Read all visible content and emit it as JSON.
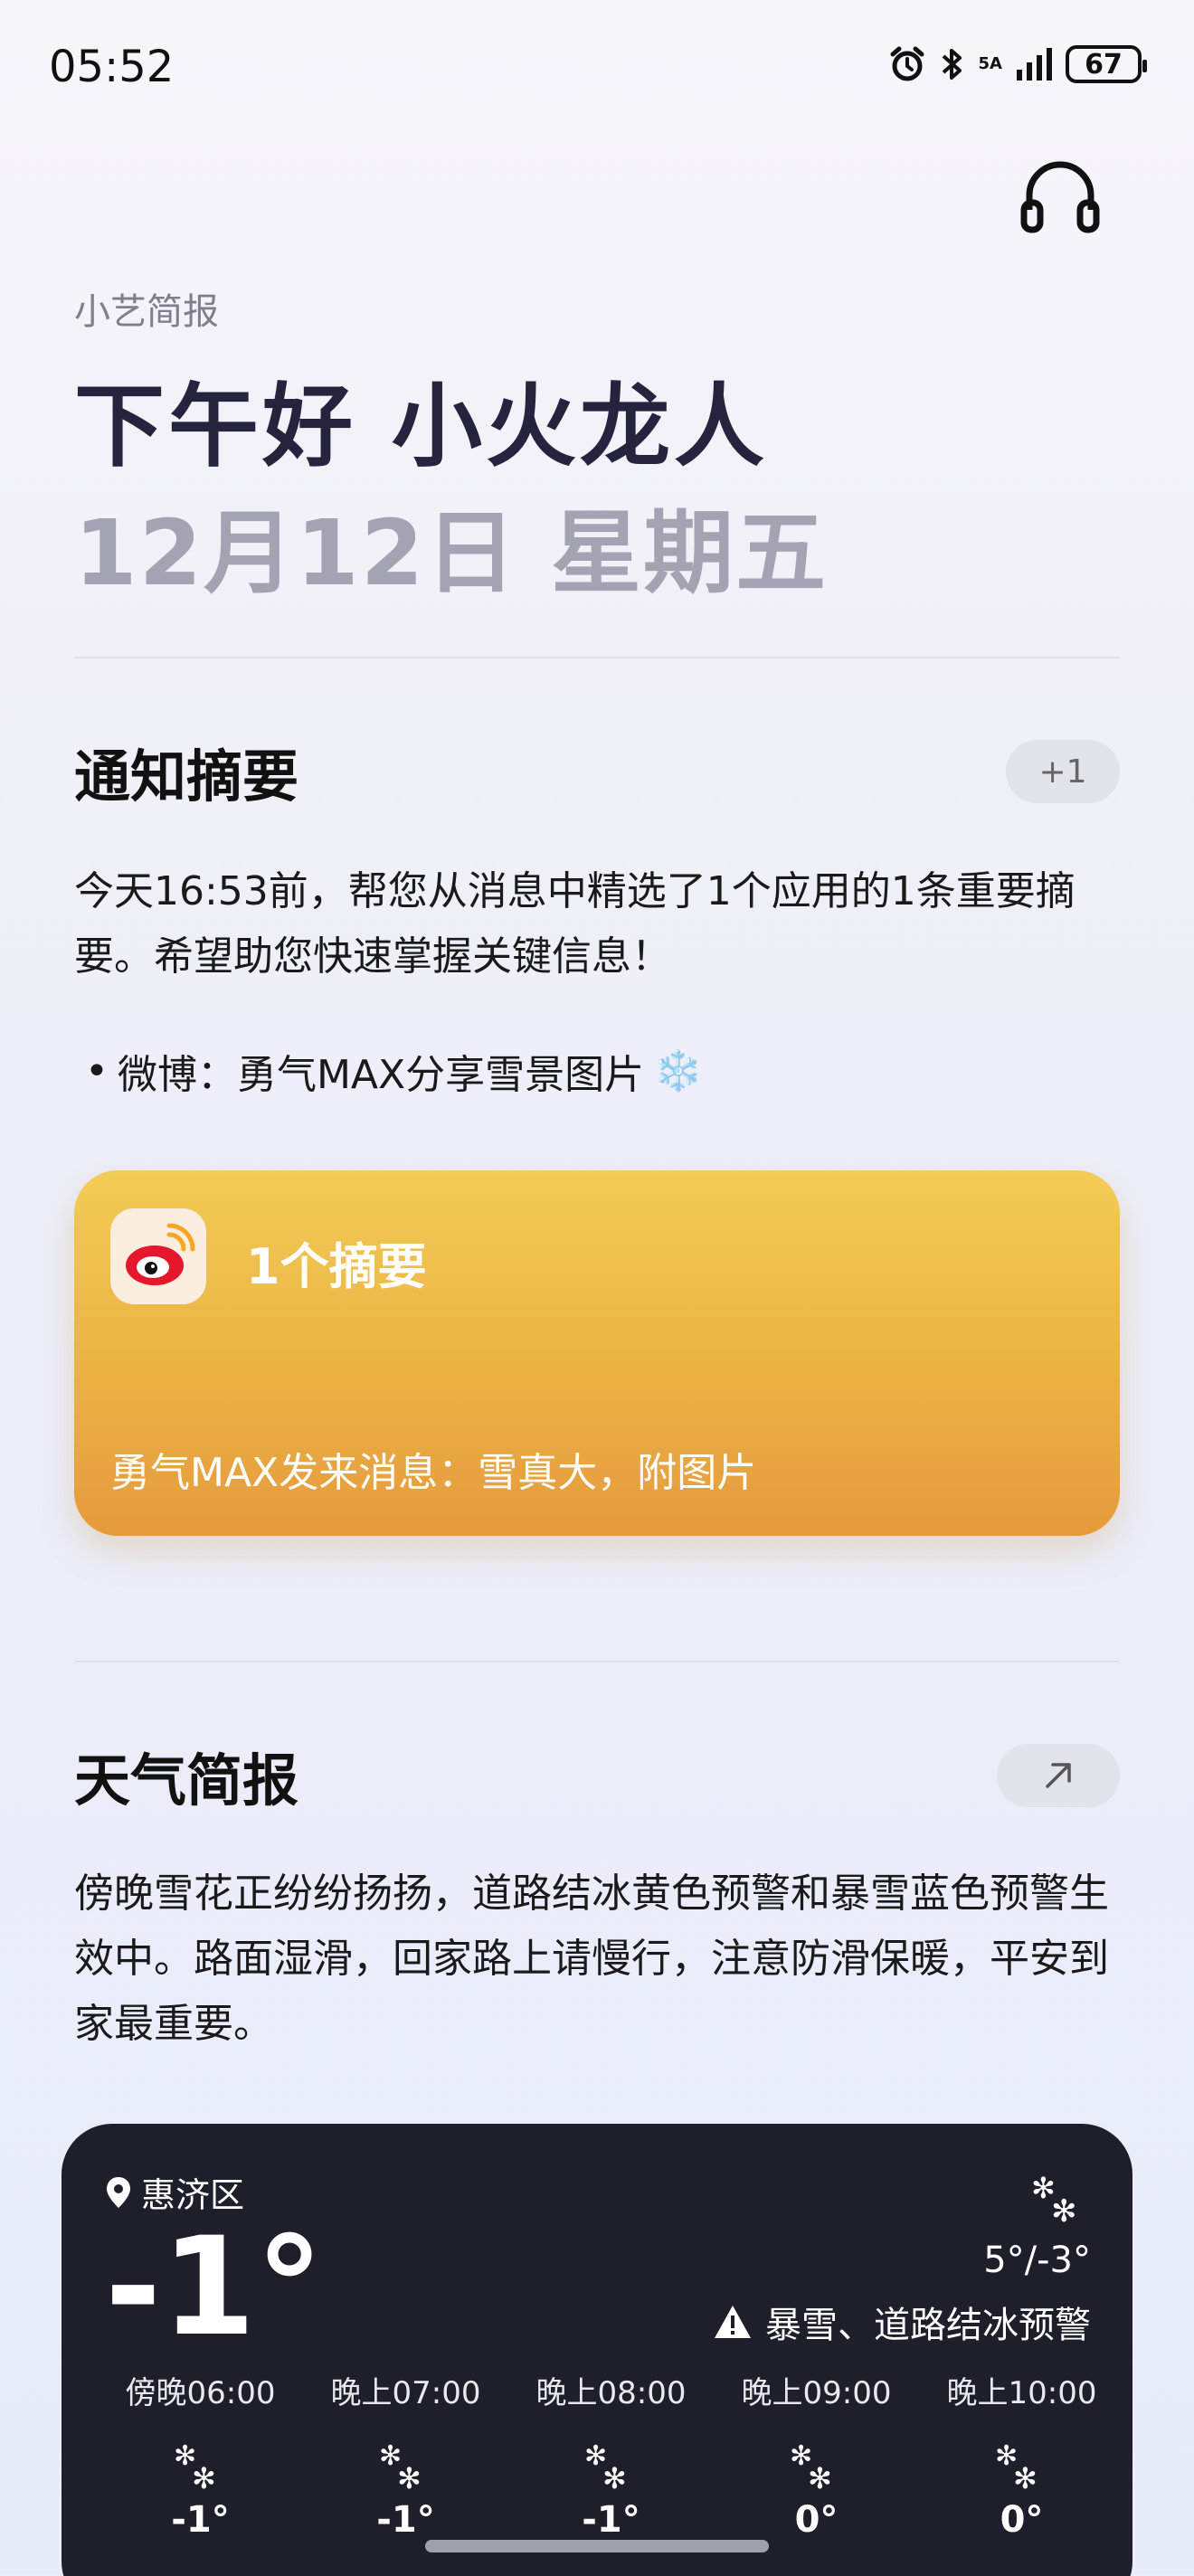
{
  "status_bar": {
    "time": "05:52",
    "battery": "67",
    "network": "5A"
  },
  "header": {
    "brief_label": "小艺简报",
    "greeting": "下午好 小火龙人",
    "date": "12月12日 星期五"
  },
  "notifications": {
    "title": "通知摘要",
    "badge": "+1",
    "summary": "今天16:53前，帮您从消息中精选了1个应用的1条重要摘要。希望助您快速掌握关键信息！",
    "bullet": "微博：勇气MAX分享雪景图片",
    "bullet_emoji": "❄️",
    "card": {
      "title": "1个摘要",
      "message": "勇气MAX发来消息：雪真大，附图片",
      "app_icon": "weibo-icon",
      "colors": {
        "top": "#f2cc55",
        "bottom": "#e69a3c"
      }
    }
  },
  "weather": {
    "title": "天气简报",
    "summary": "傍晚雪花正纷纷扬扬，道路结冰黄色预警和暴雪蓝色预警生效中。路面湿滑，回家路上请慢行，注意防滑保暖，平安到家最重要。",
    "card": {
      "location": "惠济区",
      "temperature": "-1°",
      "range": "5°/-3°",
      "warning": "暴雪、道路结冰预警",
      "hourly": [
        {
          "time": "傍晚06:00",
          "temp": "-1°",
          "icon": "snow-icon"
        },
        {
          "time": "晚上07:00",
          "temp": "-1°",
          "icon": "snow-icon"
        },
        {
          "time": "晚上08:00",
          "temp": "-1°",
          "icon": "snow-icon"
        },
        {
          "time": "晚上09:00",
          "temp": "0°",
          "icon": "snow-icon"
        },
        {
          "time": "晚上10:00",
          "temp": "0°",
          "icon": "snow-icon"
        }
      ]
    }
  }
}
